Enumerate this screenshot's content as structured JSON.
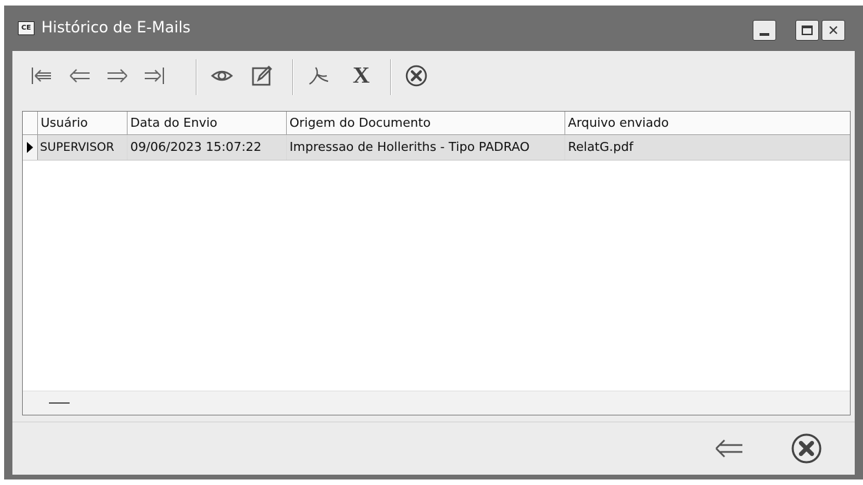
{
  "window": {
    "app_icon_text": "CE",
    "title": "Histórico de E-Mails",
    "controls": {
      "minimize": "minimize-icon",
      "maximize": "maximize-icon",
      "close": "close-icon"
    }
  },
  "toolbar": {
    "buttons": [
      {
        "name": "first-record",
        "icon": "first-record-icon"
      },
      {
        "name": "previous-record",
        "icon": "previous-arrow-icon"
      },
      {
        "name": "next-record",
        "icon": "next-arrow-icon"
      },
      {
        "name": "last-record",
        "icon": "last-record-icon"
      },
      {
        "name": "view",
        "icon": "eye-icon"
      },
      {
        "name": "edit",
        "icon": "edit-icon"
      },
      {
        "name": "pdf",
        "icon": "pdf-icon"
      },
      {
        "name": "excel",
        "icon": "excel-x-icon",
        "glyph": "X"
      },
      {
        "name": "cancel",
        "icon": "cancel-circle-icon"
      }
    ]
  },
  "grid": {
    "columns": [
      "Usuário",
      "Data do Envio",
      "Origem do Documento",
      "Arquivo enviado"
    ],
    "rows": [
      {
        "usuario": "SUPERVISOR",
        "data_envio": "09/06/2023 15:07:22",
        "origem": "Impressao de Holleriths - Tipo PADRAO",
        "arquivo": "RelatG.pdf"
      }
    ]
  },
  "footer": {
    "buttons": [
      {
        "name": "back",
        "icon": "back-arrow-icon"
      },
      {
        "name": "close",
        "icon": "cancel-circle-icon"
      }
    ]
  }
}
